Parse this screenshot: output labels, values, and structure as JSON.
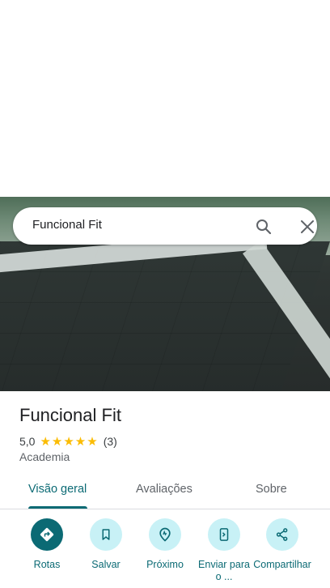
{
  "search": {
    "query": "Funcional Fit"
  },
  "place": {
    "name": "Funcional Fit",
    "rating": "5,0",
    "stars": "★★★★★",
    "reviews_count": "(3)",
    "category": "Academia"
  },
  "tabs": [
    {
      "label": "Visão geral"
    },
    {
      "label": "Avaliações"
    },
    {
      "label": "Sobre"
    }
  ],
  "actions": [
    {
      "label": "Rotas",
      "icon": "directions-icon"
    },
    {
      "label": "Salvar",
      "icon": "bookmark-icon"
    },
    {
      "label": "Próximo",
      "icon": "nearby-icon"
    },
    {
      "label": "Enviar para o ...",
      "icon": "send-to-phone-icon"
    },
    {
      "label": "Compartilhar",
      "icon": "share-icon"
    }
  ],
  "colors": {
    "accent": "#0b6a74",
    "accent_light": "#c8f1f6",
    "star": "#fbbc04"
  }
}
